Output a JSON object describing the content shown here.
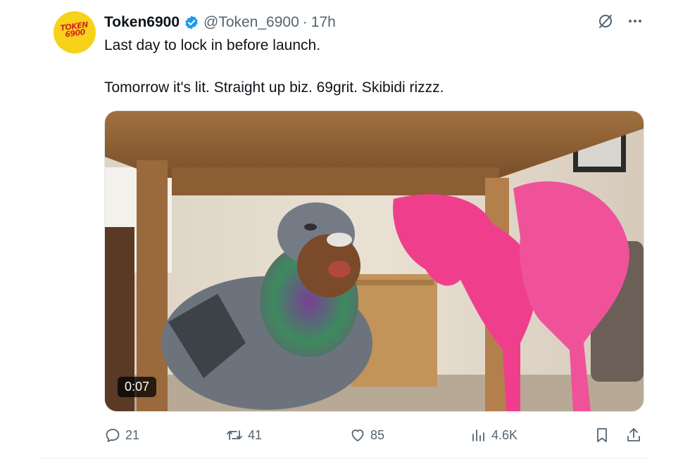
{
  "tweet": {
    "avatar_text": "TOKEN 6900",
    "display_name": "Token6900",
    "handle": "@Token_6900",
    "separator": "·",
    "time": "17h",
    "line1": "Last day to lock in before launch.",
    "line2": "Tomorrow it's lit. Straight up biz. 69grit. Skibidi rizzz.",
    "video_duration": "0:07"
  },
  "actions": {
    "replies": "21",
    "reposts": "41",
    "likes": "85",
    "views": "4.6K"
  },
  "colors": {
    "verified": "#1d9bf0",
    "muted": "#536471",
    "avatar_bg": "#f6d21a",
    "avatar_text": "#d7261e"
  },
  "icons": [
    "grok-icon",
    "more-icon",
    "reply-icon",
    "repost-icon",
    "like-icon",
    "views-icon",
    "bookmark-icon",
    "share-icon"
  ]
}
